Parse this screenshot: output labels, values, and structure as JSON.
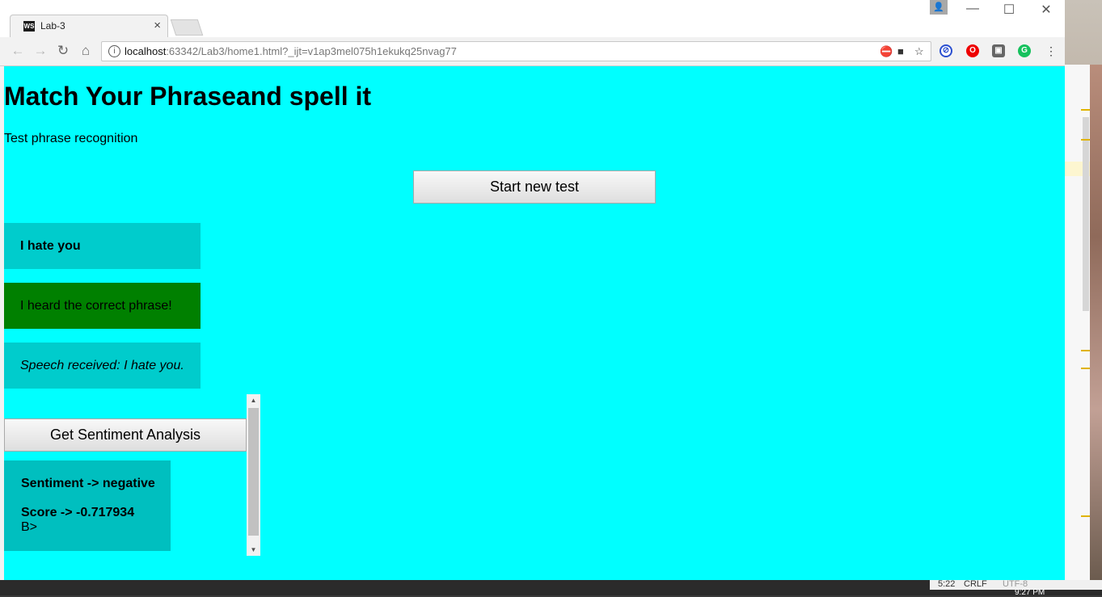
{
  "browser": {
    "tab_title": "Lab-3",
    "tab_favicon": "WS",
    "url_host": "localhost",
    "url_rest": ":63342/Lab3/home1.html?_ijt=v1ap3mel075h1ekukq25nvag77"
  },
  "page": {
    "title": "Match Your Phraseand spell it",
    "subtitle": "Test phrase recognition",
    "start_button": "Start new test",
    "phrase": "I hate you",
    "result": "I heard the correct phrase!",
    "speech": "Speech received: I hate you.",
    "sentiment_button": "Get Sentiment Analysis",
    "sentiment_line": "Sentiment -> negative",
    "score_line": "Score -> -0.717934",
    "trailing_text": "B>"
  },
  "ide_status": {
    "position": "5:22",
    "line_ending": "CRLF",
    "encoding": "UTF-8"
  },
  "clock": "9:27 PM",
  "colors": {
    "page_bg": "#00ffff",
    "panel_bg": "#00cccc",
    "success_bg": "#008000"
  },
  "icons": [
    "back-icon",
    "forward-icon",
    "reload-icon",
    "home-icon",
    "info-icon",
    "camera-blocked-icon",
    "video-icon",
    "star-icon"
  ]
}
